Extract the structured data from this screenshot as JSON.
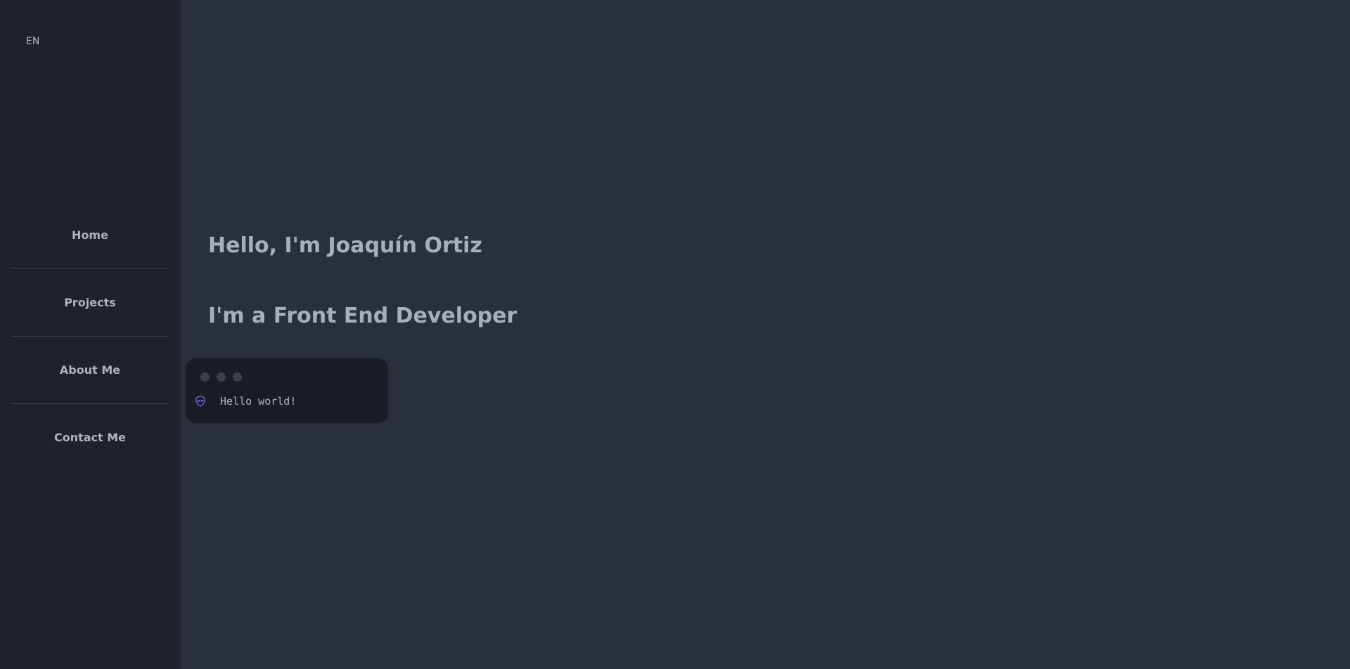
{
  "language_selector": "EN",
  "nav": {
    "items": [
      {
        "label": "Home"
      },
      {
        "label": "Projects"
      },
      {
        "label": "About Me"
      },
      {
        "label": "Contact Me"
      }
    ]
  },
  "hero": {
    "greeting": "Hello, I'm Joaquín Ortiz",
    "role": "I'm a Front End Developer"
  },
  "terminal": {
    "icon": "alien-icon",
    "text": "Hello world!"
  },
  "colors": {
    "background": "#2a2f3c",
    "sidebar": "#1f222a",
    "terminal": "#1a1d24",
    "text": "#a9afba",
    "icon_accent": "#6f5bd6"
  }
}
